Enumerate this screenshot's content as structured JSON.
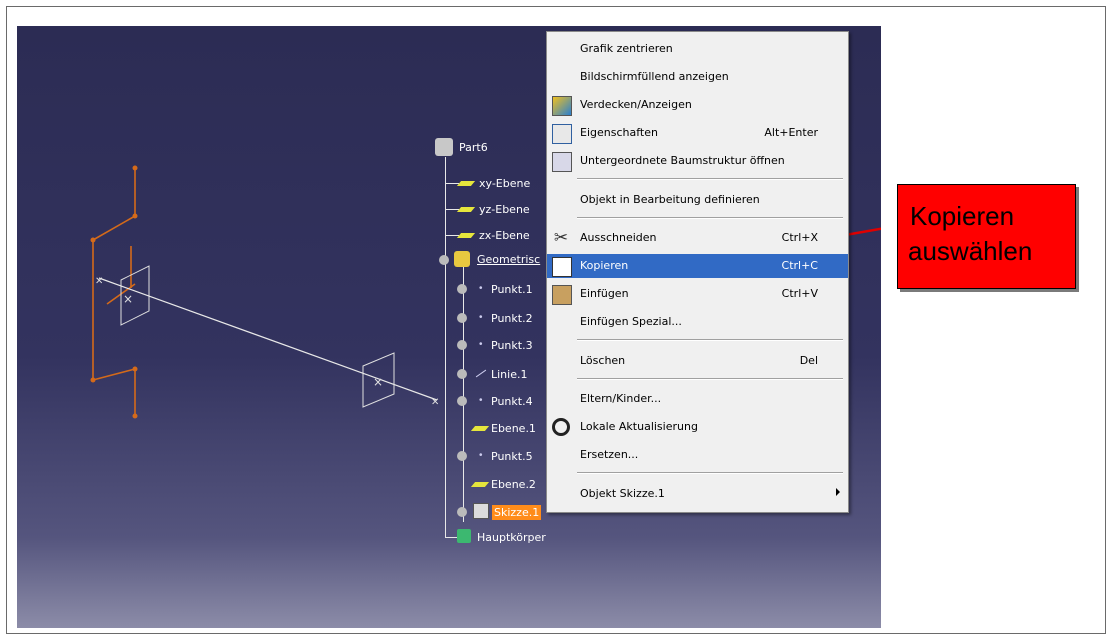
{
  "tree": {
    "root": "Part6",
    "items": [
      "xy-Ebene",
      "yz-Ebene",
      "zx-Ebene",
      "Geometrisc",
      "Punkt.1",
      "Punkt.2",
      "Punkt.3",
      "Linie.1",
      "Punkt.4",
      "Ebene.1",
      "Punkt.5",
      "Ebene.2",
      "Skizze.1",
      "Hauptkörper"
    ]
  },
  "menu": {
    "items": [
      {
        "label": "Grafik zentrieren",
        "shortcut": ""
      },
      {
        "label": "Bildschirmfüllend anzeigen",
        "shortcut": ""
      },
      {
        "label": "Verdecken/Anzeigen",
        "shortcut": ""
      },
      {
        "label": "Eigenschaften",
        "shortcut": "Alt+Enter"
      },
      {
        "label": "Untergeordnete Baumstruktur öffnen",
        "shortcut": ""
      },
      {
        "label": "Objekt in Bearbeitung definieren",
        "shortcut": ""
      },
      {
        "label": "Ausschneiden",
        "shortcut": "Ctrl+X"
      },
      {
        "label": "Kopieren",
        "shortcut": "Ctrl+C"
      },
      {
        "label": "Einfügen",
        "shortcut": "Ctrl+V"
      },
      {
        "label": "Einfügen Spezial...",
        "shortcut": ""
      },
      {
        "label": "Löschen",
        "shortcut": "Del"
      },
      {
        "label": "Eltern/Kinder...",
        "shortcut": ""
      },
      {
        "label": "Lokale Aktualisierung",
        "shortcut": ""
      },
      {
        "label": "Ersetzen...",
        "shortcut": ""
      },
      {
        "label": "Objekt Skizze.1",
        "shortcut": ""
      }
    ]
  },
  "callout": {
    "line1": "Kopieren",
    "line2": "auswählen"
  },
  "colors": {
    "background": "#2c2c54",
    "highlight": "#316ac5",
    "callout": "#ff0000",
    "sketch": "#d46a1a"
  }
}
